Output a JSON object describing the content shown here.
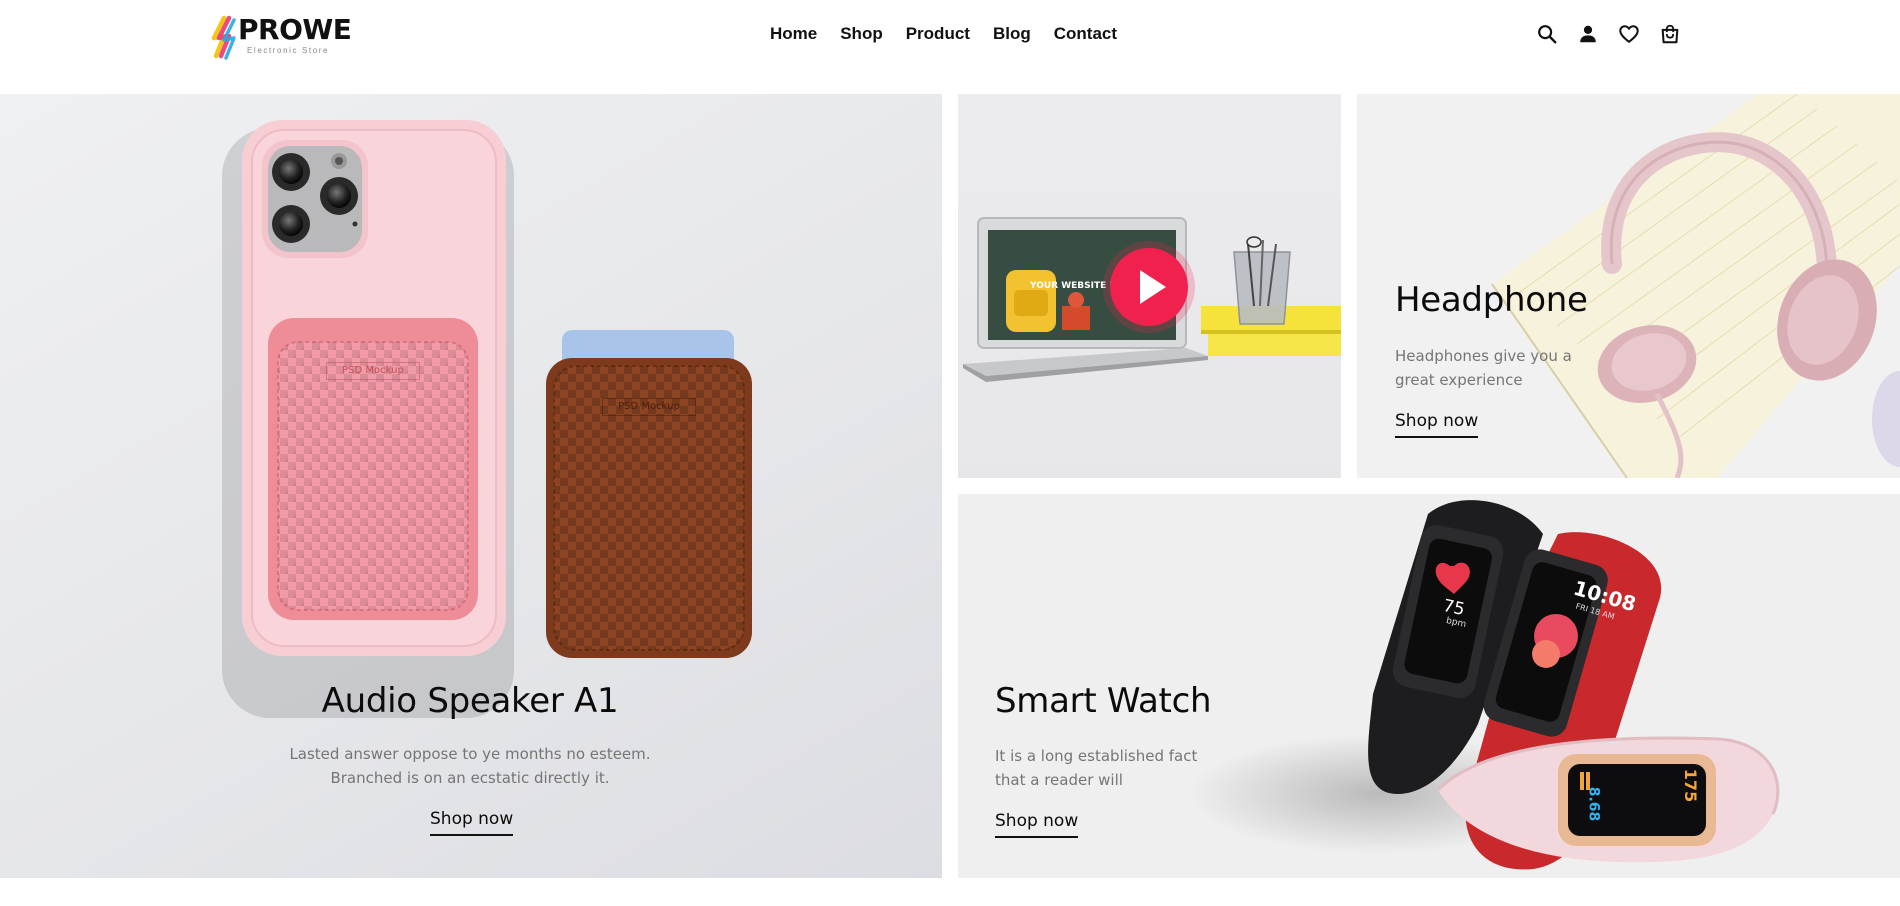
{
  "brand": {
    "name": "PROWE",
    "tagline": "Electronic Store"
  },
  "nav": {
    "items": [
      "Home",
      "Shop",
      "Product",
      "Blog",
      "Contact"
    ]
  },
  "header_icons": [
    "search-icon",
    "user-icon",
    "heart-icon",
    "bag-icon"
  ],
  "banners": {
    "speaker": {
      "title": "Audio Speaker A1",
      "desc_line1": "Lasted answer oppose to ye months no esteem.",
      "desc_line2": "Branched is on an ecstatic directly it.",
      "cta": "Shop now",
      "mockup_label": "PSD Mockup"
    },
    "video": {
      "screen_text": "YOUR WEBSITE HOME",
      "play_icon": "play-icon"
    },
    "headphone": {
      "title": "Headphone",
      "desc_line1": "Headphones give you a",
      "desc_line2": "great experience",
      "cta": "Shop now"
    },
    "watch": {
      "title": "Smart Watch",
      "desc_line1": "It is a long established fact",
      "desc_line2": "that a reader will",
      "cta": "Shop now",
      "band1_value": "75",
      "band1_unit": "bpm",
      "band2_time": "10:08",
      "band2_date": "FRI 18 AM",
      "band3_value": "175",
      "band3_alt": "8.68"
    }
  },
  "colors": {
    "accent_play": "#f0214d",
    "text_dark": "#111111",
    "text_muted": "#757575",
    "speaker_bg": "#eaebee",
    "case_pink": "#f6c9d0",
    "wallet_pink": "#f08b98",
    "wallet_brown": "#8c4423",
    "watch_red": "#c9282c"
  }
}
